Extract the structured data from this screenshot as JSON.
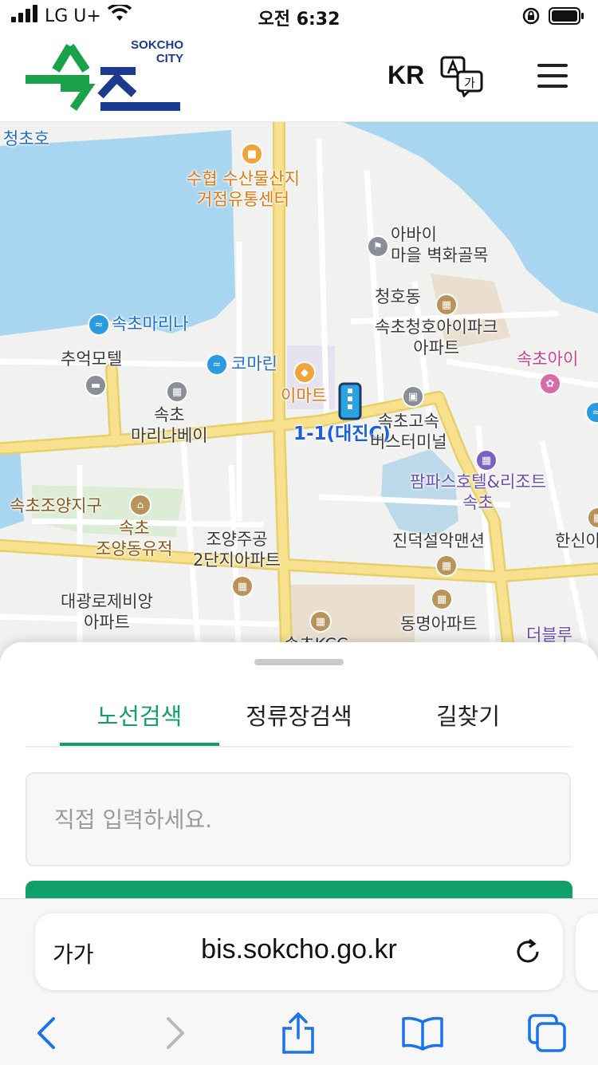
{
  "status": {
    "carrier": "LG U+",
    "time": "오전 6:32"
  },
  "header": {
    "logo_hangul": "속초",
    "logo_en_line1": "SOKCHO",
    "logo_en_line2": "CITY",
    "lang": "KR"
  },
  "map": {
    "labels": {
      "cheongchoho": "청초호",
      "suhyup_1": "수협 수산물산지",
      "suhyup_2": "거점유통센터",
      "abai_1": "아바이",
      "abai_2": "마을 벽화골목",
      "cheonghodong": "청호동",
      "marina": "속초마리나",
      "apark_1": "속초청호아이파크",
      "apark_2": "아파트",
      "chueok": "추억모텔",
      "komarin": "코마린",
      "emart": "이마트",
      "sokchoeye": "속초아이",
      "marinabay_1": "속초",
      "marinabay_2": "마리나베이",
      "route": "1-1(대진C)",
      "terminal_1": "속초고속",
      "terminal_2": "버스터미널",
      "pampas_1": "팜파스호텔&리조트",
      "pampas_2": "속초",
      "joyangjigu": "속초조양지구",
      "joyangyujeok_1": "속초",
      "joyangyujeok_2": "조양동유적",
      "jugong_1": "조양주공",
      "jugong_2": "2단지아파트",
      "jindeok": "진덕설악맨션",
      "hanshin": "한신아",
      "daegwang_1": "대광로제비앙",
      "daegwang_2": "아파트",
      "dongmyeong": "동명아파트",
      "sokcho_kcc": "속초KCC",
      "deoblue": "더블루"
    }
  },
  "sheet": {
    "tabs": [
      "노선검색",
      "정류장검색",
      "길찾기"
    ],
    "active_tab": 0,
    "search_placeholder": "직접 입력하세요."
  },
  "safari": {
    "aa": "가가",
    "url": "bis.sokcho.go.kr"
  },
  "colors": {
    "accent": "#12a06a",
    "water": "#a8d5ef",
    "road": "#f7e08e",
    "logo_green": "#1aa24a",
    "logo_navy": "#1c3b8e"
  }
}
